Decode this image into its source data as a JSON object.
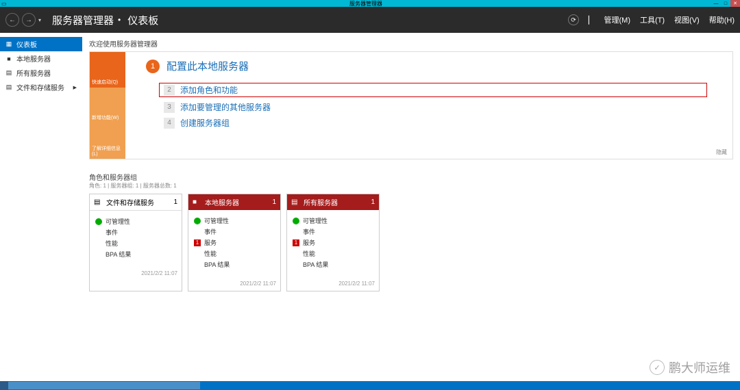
{
  "window": {
    "title": "服务器管理器",
    "min": "—",
    "max": "□",
    "close": "✕"
  },
  "header": {
    "app": "服务器管理器",
    "sep": "•",
    "page": "仪表板",
    "menu": {
      "manage": "管理(M)",
      "tools": "工具(T)",
      "view": "视图(V)",
      "help": "帮助(H)"
    }
  },
  "sidebar": {
    "items": [
      {
        "icon": "▦",
        "label": "仪表板",
        "active": true
      },
      {
        "icon": "■",
        "label": "本地服务器"
      },
      {
        "icon": "▤",
        "label": "所有服务器"
      },
      {
        "icon": "▤",
        "label": "文件和存储服务",
        "arrow": "▶"
      }
    ]
  },
  "welcome": {
    "title": "欢迎使用服务器管理器",
    "tabs": {
      "quick": "快速启动(Q)",
      "new": "新增功能(W)",
      "learn": "了解详细信息(L)"
    },
    "steps": {
      "s1": {
        "num": "1",
        "label": "配置此本地服务器"
      },
      "s2": {
        "num": "2",
        "label": "添加角色和功能"
      },
      "s3": {
        "num": "3",
        "label": "添加要管理的其他服务器"
      },
      "s4": {
        "num": "4",
        "label": "创建服务器组"
      }
    },
    "hide": "隐藏"
  },
  "roles": {
    "section": "角色和服务器组",
    "sub": "角色: 1 | 服务器组: 1 | 服务器总数: 1",
    "tiles": [
      {
        "icon": "▤",
        "title": "文件和存储服务",
        "count": "1",
        "dark": false,
        "rows": [
          {
            "badge": "green",
            "badgeText": "⬤",
            "label": "可管理性"
          },
          {
            "badge": "empty",
            "badgeText": "",
            "label": "事件"
          },
          {
            "badge": "empty",
            "badgeText": "",
            "label": "性能"
          },
          {
            "badge": "empty",
            "badgeText": "",
            "label": "BPA 结果"
          }
        ],
        "time": "2021/2/2 11:07"
      },
      {
        "icon": "■",
        "title": "本地服务器",
        "count": "1",
        "dark": true,
        "rows": [
          {
            "badge": "green",
            "badgeText": "⬤",
            "label": "可管理性"
          },
          {
            "badge": "empty",
            "badgeText": "",
            "label": "事件"
          },
          {
            "badge": "red",
            "badgeText": "1",
            "label": "服务"
          },
          {
            "badge": "empty",
            "badgeText": "",
            "label": "性能"
          },
          {
            "badge": "empty",
            "badgeText": "",
            "label": "BPA 结果"
          }
        ],
        "time": "2021/2/2 11:07"
      },
      {
        "icon": "▤",
        "title": "所有服务器",
        "count": "1",
        "dark": true,
        "rows": [
          {
            "badge": "green",
            "badgeText": "⬤",
            "label": "可管理性"
          },
          {
            "badge": "empty",
            "badgeText": "",
            "label": "事件"
          },
          {
            "badge": "red",
            "badgeText": "1",
            "label": "服务"
          },
          {
            "badge": "empty",
            "badgeText": "",
            "label": "性能"
          },
          {
            "badge": "empty",
            "badgeText": "",
            "label": "BPA 结果"
          }
        ],
        "time": "2021/2/2 11:07"
      }
    ]
  },
  "watermark": {
    "text": "鹏大师运维"
  }
}
